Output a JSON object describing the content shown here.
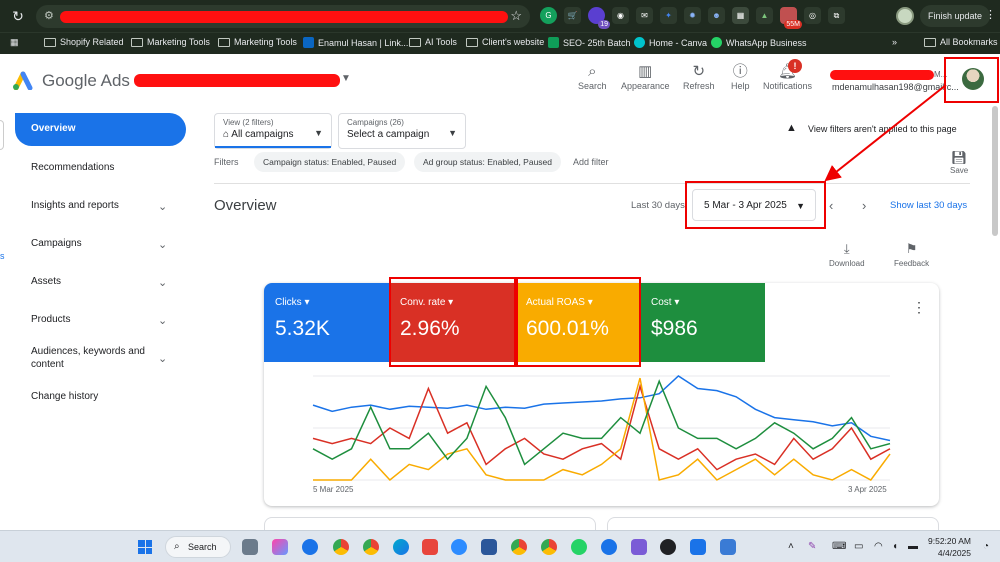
{
  "browser": {
    "finish_update": "Finish update",
    "ext_badges": [
      "19",
      "55M"
    ],
    "bookmarks": [
      "Shopify Related",
      "Marketing Tools",
      "Marketing Tools",
      "Enamul Hasan | Link...",
      "AI Tools",
      "Client's website",
      "SEO- 25th Batch",
      "Home - Canva",
      "WhatsApp Business"
    ],
    "all_bookmarks": "All Bookmarks"
  },
  "header": {
    "product": "Google Ads",
    "search": "Search",
    "appearance": "Appearance",
    "refresh": "Refresh",
    "help": "Help",
    "notifications": "Notifications",
    "notif_count": "!",
    "account_suffix": "M...",
    "email": "mdenamulhasan198@gmail.c..."
  },
  "sidebar": {
    "items": [
      "Overview",
      "Recommendations",
      "Insights and reports",
      "Campaigns",
      "Assets",
      "Products",
      "Audiences, keywords and content",
      "Change history"
    ],
    "side_label": "s"
  },
  "filters": {
    "view_small": "View (2 filters)",
    "view_value": "All campaigns",
    "campaigns_small": "Campaigns (26)",
    "campaigns_value": "Select a campaign",
    "warning": "View filters aren't applied to this page",
    "label": "Filters",
    "chips": [
      "Campaign status: Enabled, Paused",
      "Ad group status: Enabled, Paused"
    ],
    "add_filter": "Add filter",
    "save": "Save"
  },
  "overview": {
    "title": "Overview",
    "last30": "Last 30 days",
    "date_range": "5 Mar - 3 Apr 2025",
    "show_last": "Show last 30 days",
    "download": "Download",
    "feedback": "Feedback"
  },
  "metrics": [
    {
      "label": "Clicks",
      "value": "5.32K",
      "color": "#1a73e8"
    },
    {
      "label": "Conv. rate",
      "value": "2.96%",
      "color": "#d93025"
    },
    {
      "label": "Actual ROAS",
      "value": "600.01%",
      "color": "#f9ab00"
    },
    {
      "label": "Cost",
      "value": "$986",
      "color": "#1e8e3e"
    }
  ],
  "chart_data": {
    "type": "line",
    "x_start_label": "5 Mar 2025",
    "x_end_label": "3 Apr 2025",
    "series": [
      {
        "name": "Clicks",
        "color": "#1a73e8",
        "values": [
          0.72,
          0.66,
          0.7,
          0.72,
          0.68,
          0.71,
          0.7,
          0.69,
          0.72,
          0.68,
          0.7,
          0.69,
          0.73,
          0.74,
          0.75,
          0.76,
          0.78,
          0.79,
          0.83,
          1.0,
          0.88,
          0.86,
          0.8,
          0.68,
          0.6,
          0.58,
          0.56,
          0.52,
          0.55,
          0.42,
          0.38
        ]
      },
      {
        "name": "Conv. rate",
        "color": "#d93025",
        "values": [
          0.4,
          0.35,
          0.4,
          0.35,
          0.5,
          0.4,
          0.88,
          0.45,
          0.55,
          0.15,
          0.3,
          0.4,
          0.25,
          0.2,
          0.3,
          0.35,
          0.2,
          0.9,
          0.3,
          0.2,
          0.3,
          0.1,
          0.2,
          0.25,
          0.15,
          0.4,
          0.2,
          0.3,
          0.5,
          0.2,
          0.3
        ]
      },
      {
        "name": "Actual ROAS",
        "color": "#f9ab00",
        "values": [
          0.0,
          0.0,
          0.0,
          0.2,
          0.0,
          0.15,
          0.1,
          0.25,
          0.3,
          0.05,
          0.0,
          0.0,
          0.0,
          0.1,
          0.05,
          0.15,
          0.3,
          0.98,
          0.0,
          0.05,
          0.2,
          0.0,
          0.1,
          0.2,
          0.05,
          0.2,
          0.05,
          0.0,
          0.1,
          0.0,
          0.25
        ]
      },
      {
        "name": "Cost",
        "color": "#1e8e3e",
        "values": [
          0.3,
          0.2,
          0.3,
          0.7,
          0.3,
          0.3,
          0.45,
          0.2,
          0.4,
          0.9,
          0.6,
          0.15,
          0.3,
          0.45,
          0.4,
          0.4,
          0.6,
          0.45,
          0.95,
          0.5,
          0.4,
          0.4,
          0.3,
          0.4,
          0.55,
          0.45,
          0.3,
          0.4,
          0.6,
          0.3,
          0.35
        ]
      }
    ]
  },
  "taskbar": {
    "search": "Search",
    "time": "9:52:20 AM",
    "date": "4/4/2025"
  }
}
